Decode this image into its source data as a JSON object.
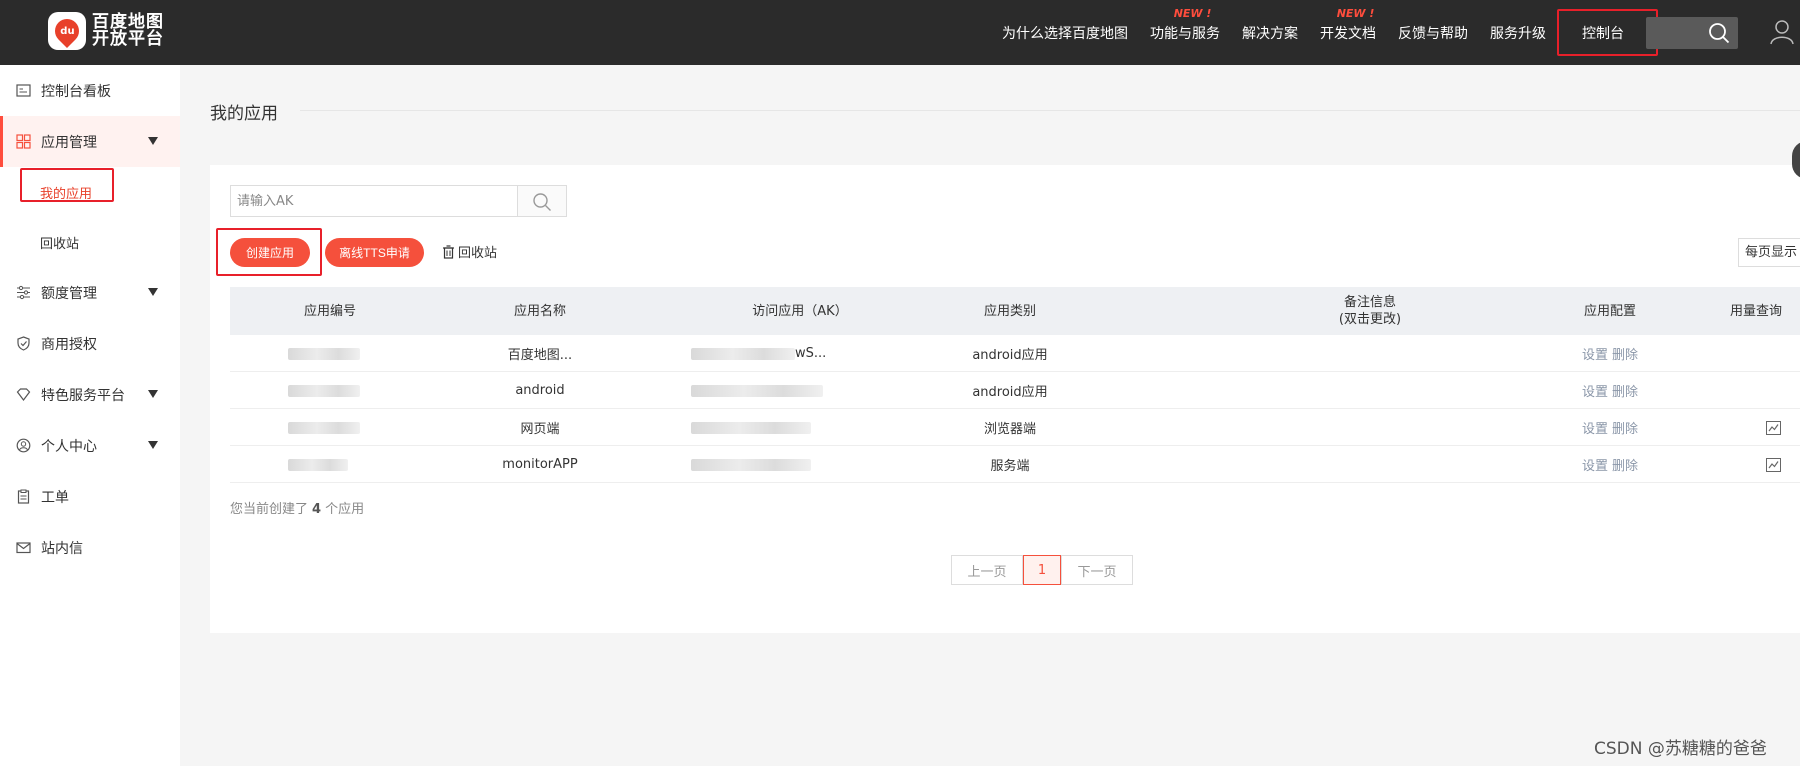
{
  "header": {
    "logo_line1": "百度地图",
    "logo_line2": "开放平台",
    "logo_badge": "du",
    "nav": [
      {
        "label": "为什么选择百度地图",
        "badge": ""
      },
      {
        "label": "功能与服务",
        "badge": "NEW !"
      },
      {
        "label": "解决方案",
        "badge": ""
      },
      {
        "label": "开发文档",
        "badge": "NEW !"
      },
      {
        "label": "反馈与帮助",
        "badge": ""
      },
      {
        "label": "服务升级",
        "badge": ""
      }
    ],
    "console_label": "控制台"
  },
  "sidebar": {
    "items": [
      {
        "label": "控制台看板"
      },
      {
        "label": "应用管理"
      },
      {
        "label": "我的应用"
      },
      {
        "label": "回收站"
      },
      {
        "label": "额度管理"
      },
      {
        "label": "商用授权"
      },
      {
        "label": "特色服务平台"
      },
      {
        "label": "个人中心"
      },
      {
        "label": "工单"
      },
      {
        "label": "站内信"
      }
    ]
  },
  "main": {
    "page_title": "我的应用",
    "search_placeholder": "请输入AK",
    "create_button": "创建应用",
    "tts_button": "离线TTS申请",
    "recycle_label": "回收站",
    "page_size_label": "每页显示",
    "table": {
      "headers": [
        "应用编号",
        "应用名称",
        "访问应用（AK）",
        "应用类别",
        "备注信息",
        "(双击更改)",
        "应用配置",
        "用量查询"
      ],
      "rows": [
        {
          "name": "百度地图...",
          "ak_suffix": "wS...",
          "category": "android应用",
          "usage_icon": false
        },
        {
          "name": "android",
          "ak_suffix": "",
          "category": "android应用",
          "usage_icon": false
        },
        {
          "name": "网页端",
          "ak_suffix": "",
          "category": "浏览器端",
          "usage_icon": true
        },
        {
          "name": "monitorAPP",
          "ak_suffix": "",
          "category": "服务端",
          "usage_icon": true
        }
      ],
      "action_settings": "设置",
      "action_delete": "删除"
    },
    "total_prefix": "您当前创建了",
    "total_count": "4",
    "total_suffix": "个应用",
    "pager": {
      "prev": "上一页",
      "current": "1",
      "next": "下一页"
    }
  },
  "watermark": "CSDN @苏糖糖的爸爸",
  "colors": {
    "accent": "#f5503c",
    "topbar": "#2b2b2b",
    "highlight": "#e8202a"
  }
}
